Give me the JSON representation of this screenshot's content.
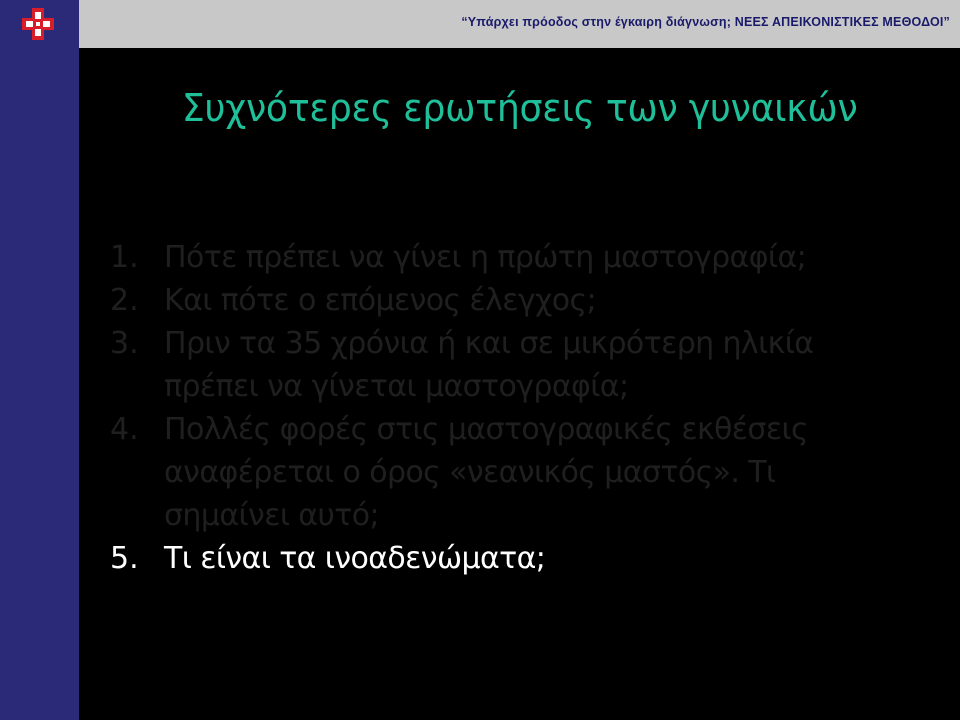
{
  "header": {
    "text": "“Υπάρχει πρόοδος στην έγκαιρη διάγνωση;  ΝΕΕΣ ΑΠΕΙΚΟΝΙΣΤΙΚΕΣ  ΜΕΘΟΔΟΙ”"
  },
  "logo": {
    "icon": "red-cross-logo-icon",
    "colors": {
      "red": "#d81e2a",
      "white": "#ffffff"
    }
  },
  "title": "Συχνότερες ερωτήσεις των γυναικών",
  "questions": [
    {
      "number": "1.",
      "lines": [
        "Πότε πρέπει να γίνει η πρώτη μαστογραφία;"
      ],
      "active": false
    },
    {
      "number": "2.",
      "lines": [
        "Και πότε ο επόμενος έλεγχος;"
      ],
      "active": false
    },
    {
      "number": "3.",
      "lines": [
        "Πριν τα 35 χρόνια ή και σε μικρότερη ηλικία",
        "πρέπει να γίνεται μαστογραφία;"
      ],
      "active": false
    },
    {
      "number": "4.",
      "lines": [
        "Πολλές φορές στις μαστογραφικές εκθέσεις",
        "αναφέρεται ο όρος «νεανικός μαστός».  Τι",
        "σημαίνει αυτό;"
      ],
      "active": false
    },
    {
      "number": "5.",
      "lines": [
        "Τι είναι τα ινοαδενώματα;"
      ],
      "active": true
    }
  ],
  "colors": {
    "background": "#000000",
    "sidebar": "#2a2a78",
    "header_bar": "#c8c8c8",
    "header_text": "#1a1a6a",
    "title": "#1fbf9a",
    "inactive_text": "#1f1f1f",
    "active_text": "#ffffff"
  }
}
